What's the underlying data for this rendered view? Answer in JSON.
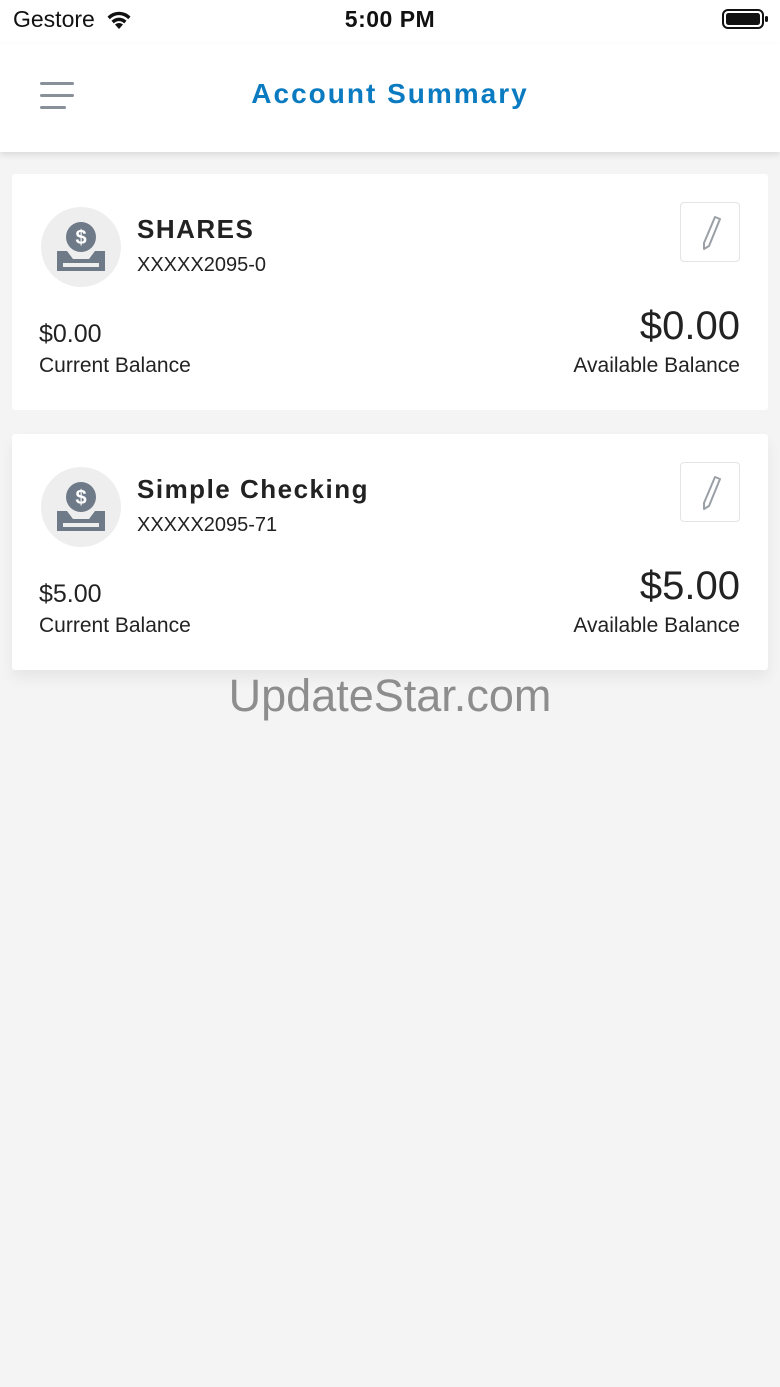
{
  "status_bar": {
    "carrier": "Gestore",
    "time": "5:00 PM",
    "icons": [
      "wifi-icon",
      "battery-icon"
    ]
  },
  "header": {
    "title": "Account Summary",
    "menu_icon": "hamburger-menu-icon",
    "title_color": "#0a7bc1"
  },
  "accounts": [
    {
      "name": "SHARES",
      "number": "XXXXX2095-0",
      "current_balance": "$0.00",
      "current_balance_label": "Current Balance",
      "available_balance": "$0.00",
      "available_balance_label": "Available Balance",
      "icon": "money-bag-icon",
      "edit_icon": "pencil-icon"
    },
    {
      "name": "Simple Checking",
      "number": "XXXXX2095-71",
      "current_balance": "$5.00",
      "current_balance_label": "Current Balance",
      "available_balance": "$5.00",
      "available_balance_label": "Available Balance",
      "icon": "money-bag-icon",
      "edit_icon": "pencil-icon"
    }
  ],
  "watermark": "UpdateStar.com"
}
